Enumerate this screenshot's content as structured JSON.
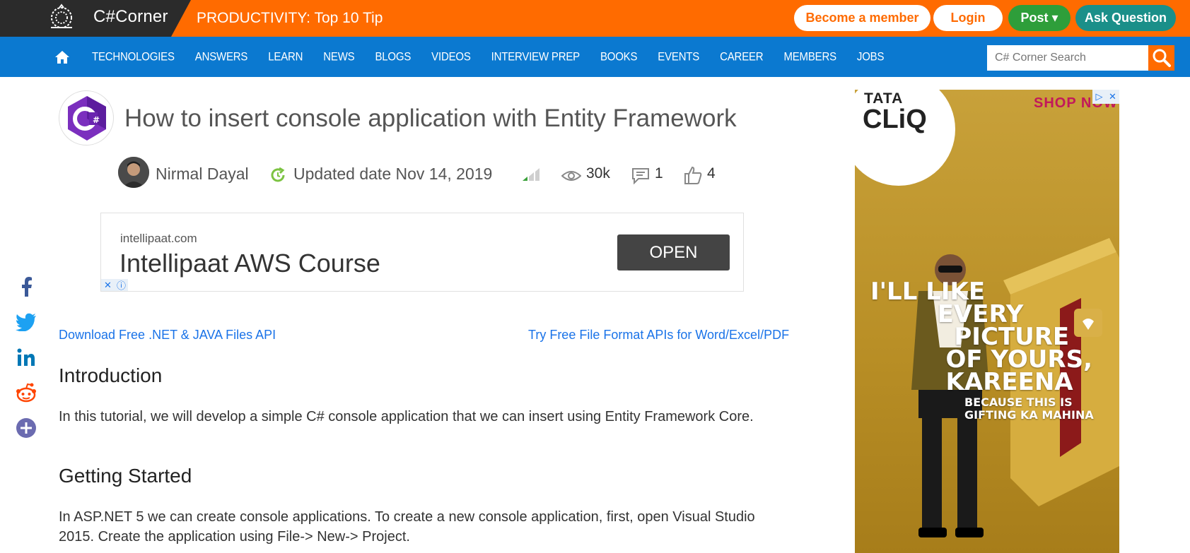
{
  "topbar": {
    "logo_text": "C#Corner",
    "promo": "PRODUCTIVITY: Top 10 Tip",
    "become_member": "Become a member",
    "login": "Login",
    "post": "Post ▾",
    "ask_question": "Ask Question"
  },
  "nav": {
    "items": [
      "TECHNOLOGIES",
      "ANSWERS",
      "LEARN",
      "NEWS",
      "BLOGS",
      "VIDEOS",
      "INTERVIEW PREP",
      "BOOKS",
      "EVENTS",
      "CAREER",
      "MEMBERS",
      "JOBS"
    ],
    "search_placeholder": "C# Corner Search"
  },
  "article": {
    "title": "How to insert console application with Entity Framework",
    "author": "Nirmal Dayal",
    "updated": "Updated date Nov 14, 2019",
    "views": "30k",
    "comments": "1",
    "likes": "4"
  },
  "ad_banner": {
    "domain": "intellipaat.com",
    "headline": "Intellipaat AWS Course",
    "cta": "OPEN"
  },
  "links": {
    "left": "Download Free .NET & JAVA Files API",
    "right": "Try Free File Format APIs for Word/Excel/PDF"
  },
  "content": {
    "h_intro": "Introduction",
    "p_intro": "In this tutorial, we will develop a simple C# console application that we can insert using Entity Framework Core.",
    "h_getting_started": "Getting Started",
    "p_getting_started": "In ASP.NET 5 we can create console applications. To create a new console application, first, open Visual Studio 2015. Create the application using File-> New-> Project."
  },
  "side_ad": {
    "shop": "SHOP NOW",
    "brand_top": "TATA",
    "brand_name": "CLiQ",
    "quote": "I'LL LIKE\n        EVERY\n          PICTURE\n         OF YOURS,\n         KAREENA",
    "sub": "BECAUSE THIS IS GIFTING KA MAHINA"
  },
  "colors": {
    "orange": "#ff6b00",
    "nav_blue": "#0b79d0",
    "post_green": "#2e9e3a",
    "ask_teal": "#1a8f89",
    "link_blue": "#1a73e8"
  }
}
